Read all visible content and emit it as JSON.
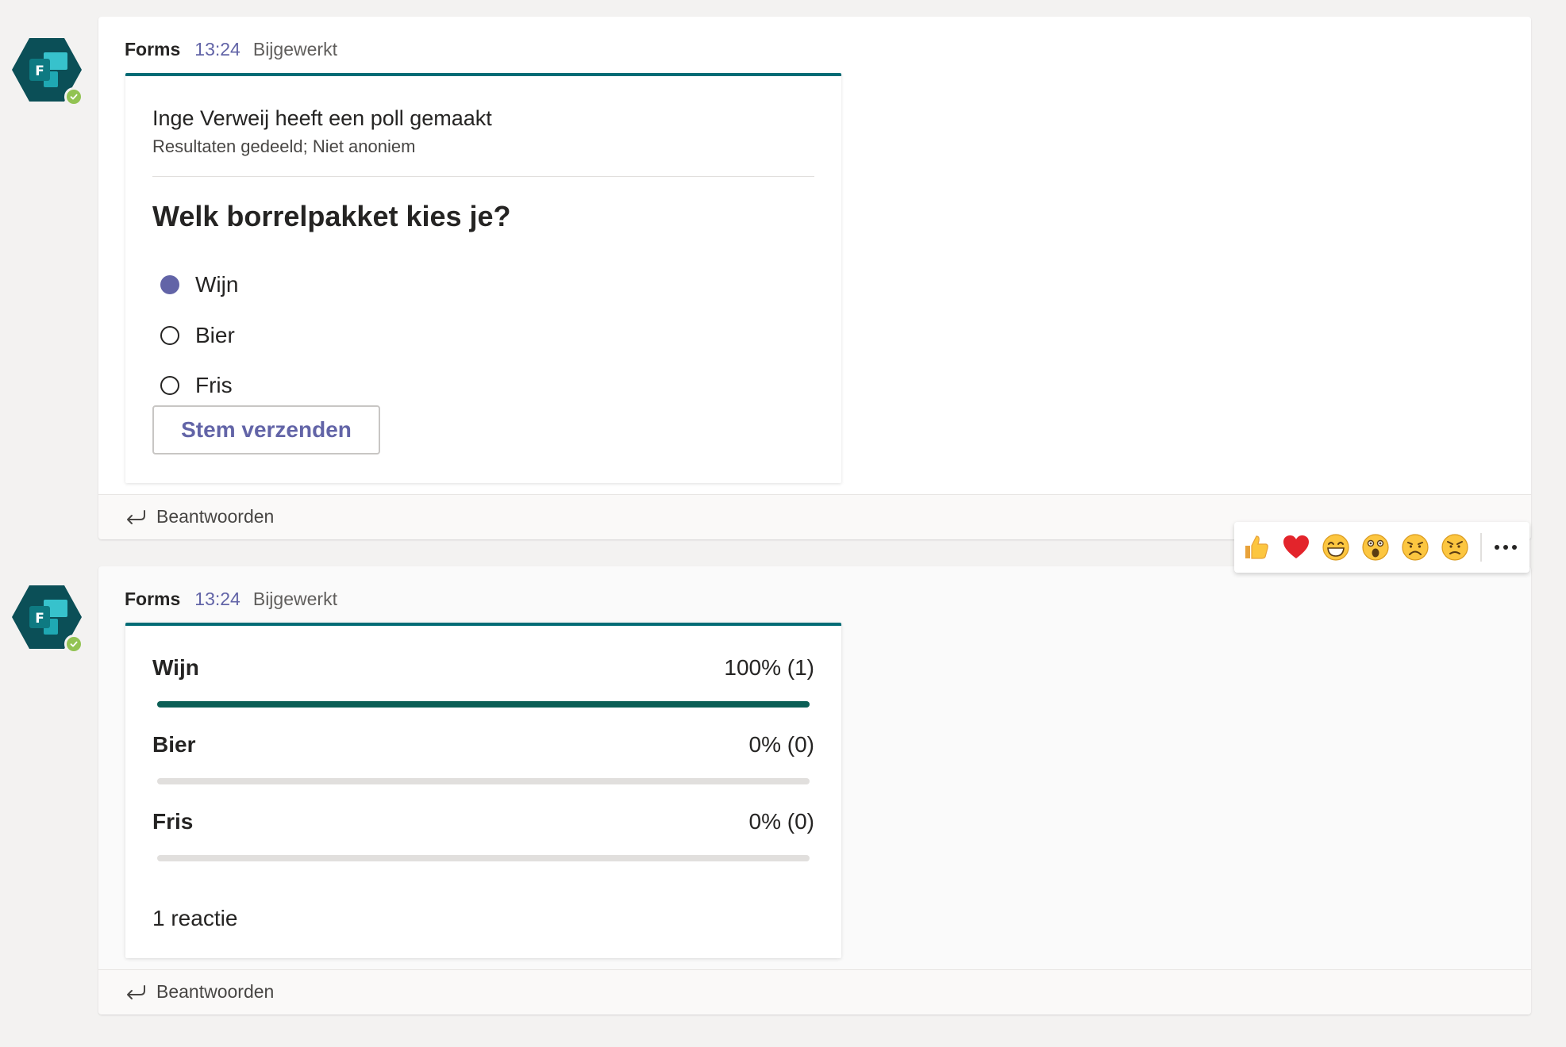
{
  "messages": [
    {
      "sender": "Forms",
      "time": "13:24",
      "edited": "Bijgewerkt",
      "reply": "Beantwoorden",
      "poll": {
        "creator": "Inge Verweij heeft een poll gemaakt",
        "settings": "Resultaten gedeeld; Niet anoniem",
        "question": "Welk borrelpakket kies je?",
        "options": [
          {
            "label": "Wijn",
            "selected": true
          },
          {
            "label": "Bier",
            "selected": false
          },
          {
            "label": "Fris",
            "selected": false
          }
        ],
        "submit": "Stem verzenden"
      }
    },
    {
      "sender": "Forms",
      "time": "13:24",
      "edited": "Bijgewerkt",
      "reply": "Beantwoorden",
      "results": {
        "rows": [
          {
            "label": "Wijn",
            "value": "100% (1)",
            "fraction": 1.0
          },
          {
            "label": "Bier",
            "value": "0% (0)",
            "fraction": 0.0
          },
          {
            "label": "Fris",
            "value": "0% (0)",
            "fraction": 0.0
          }
        ],
        "responses": "1 reactie"
      }
    }
  ],
  "reactions": [
    "like-icon",
    "heart-icon",
    "laugh-icon",
    "surprised-icon",
    "sad-icon",
    "angry-icon",
    "more-options-icon"
  ],
  "colors": {
    "brand": "#6264a7",
    "card_accent": "#006b75",
    "result_bar": "#0b5f56",
    "presence": "#92c353"
  }
}
